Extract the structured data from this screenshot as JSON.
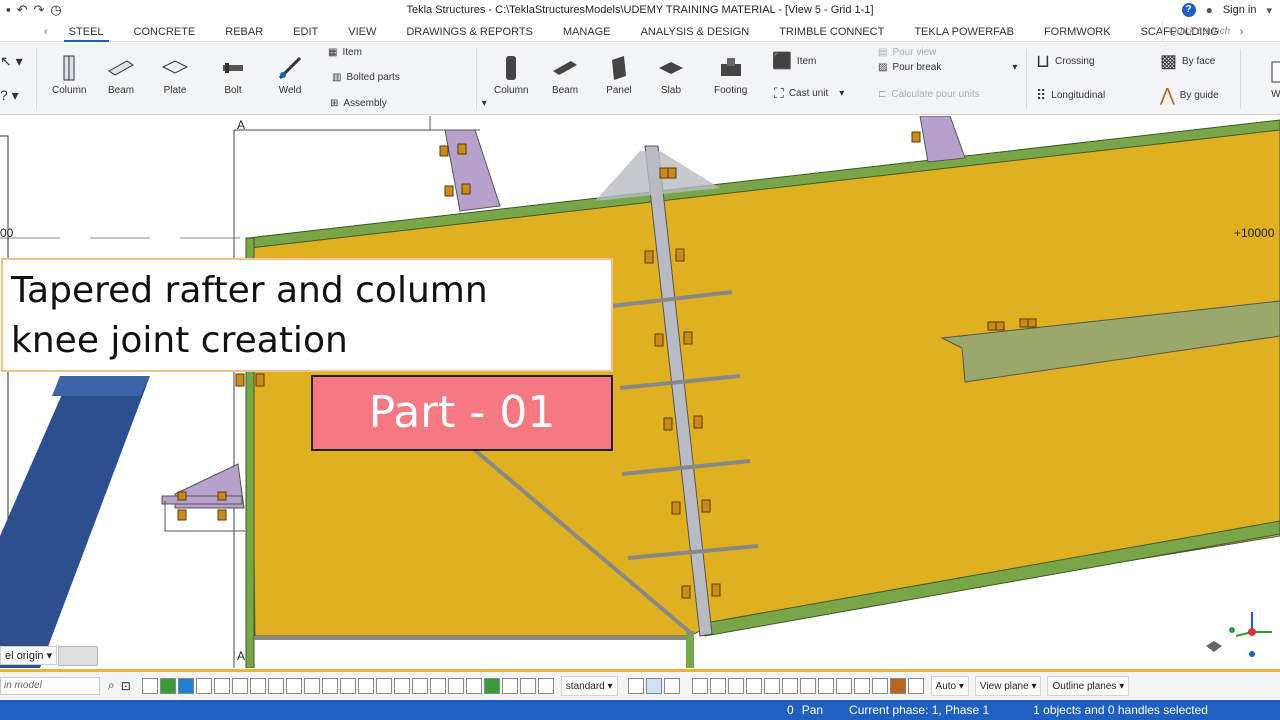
{
  "titlebar": {
    "title": "Tekla Structures - C:\\TeklaStructuresModels\\UDEMY TRAINING MATERIAL  - [View 5 - Grid 1-1]",
    "sign_in": "Sign in"
  },
  "tabs": [
    "STEEL",
    "CONCRETE",
    "REBAR",
    "EDIT",
    "VIEW",
    "DRAWINGS & REPORTS",
    "MANAGE",
    "ANALYSIS & DESIGN",
    "TRIMBLE CONNECT",
    "TEKLA POWERFAB",
    "FORMWORK",
    "SCAFFOLDING"
  ],
  "active_tab": "STEEL",
  "quick_launch": "Quick Launch",
  "ribbon": {
    "steel": {
      "column": "Column",
      "beam": "Beam",
      "plate": "Plate",
      "bolt": "Bolt",
      "weld": "Weld",
      "item": "Item",
      "bolted_parts": "Bolted parts",
      "assembly": "Assembly"
    },
    "concrete": {
      "column": "Column",
      "beam": "Beam",
      "panel": "Panel",
      "slab": "Slab",
      "footing": "Footing",
      "item": "Item",
      "cast_unit": "Cast unit",
      "pour_view": "Pour view",
      "pour_break": "Pour break",
      "calculate_pour_units": "Calculate pour units"
    },
    "rebar": {
      "crossing": "Crossing",
      "longitudinal": "Longitudinal",
      "by_face": "By face",
      "by_guide": "By guide",
      "cut_label": "Wi"
    }
  },
  "viewport": {
    "grid_label_a_top": "A",
    "grid_label_a_bottom": "A",
    "elevation_left": "00",
    "elevation_right": "+10000",
    "overlay_title_line1": "Tapered rafter and column",
    "overlay_title_line2": "knee joint creation",
    "part_label": "Part - 01",
    "origin_select": "el origin"
  },
  "bottombar": {
    "search_placeholder": "in model",
    "standard": "standard",
    "auto": "Auto",
    "view_plane": "View plane",
    "outline_planes": "Outline planes"
  },
  "statusbar": {
    "count": "0",
    "mode": "Pan",
    "phase": "Current phase: 1, Phase 1",
    "selection": "1 objects and 0 handles selected"
  },
  "colors": {
    "accent": "#1f5fbf",
    "plate_yellow": "#dfb020",
    "flange_green": "#7aa64a",
    "overlay_pink": "#f47983",
    "column_blue": "#2b4f8f"
  }
}
